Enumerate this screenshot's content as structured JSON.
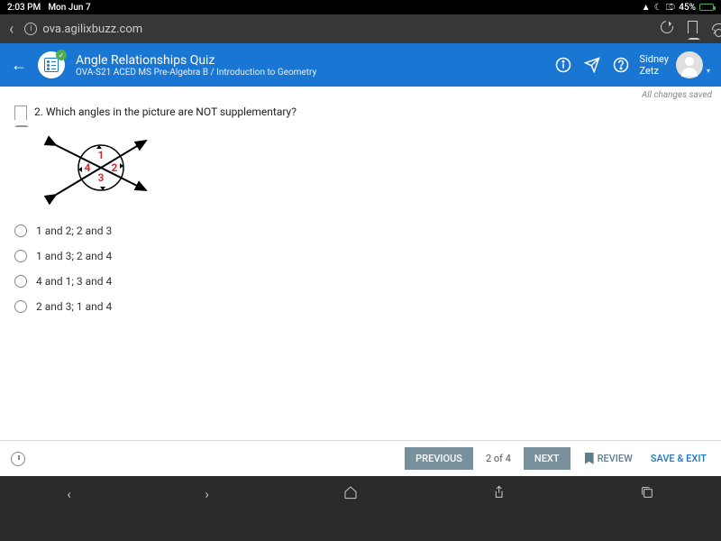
{
  "status": {
    "time": "2:03 PM",
    "date": "Mon Jun 7",
    "battery": "45%"
  },
  "browser": {
    "url": "ova.agilixbuzz.com"
  },
  "header": {
    "title": "Angle Relationships Quiz",
    "subtitle": "OVA-S21 ACED MS Pre-Algebra B / Introduction to Geometry",
    "user_first": "Sidney",
    "user_last": "Zetz"
  },
  "saved_text": "All changes saved",
  "question": {
    "number": "2.",
    "text": "Which angles in the picture are NOT supplementary?"
  },
  "diagram_labels": {
    "a1": "1",
    "a2": "2",
    "a3": "3",
    "a4": "4"
  },
  "options": [
    "1 and 2; 2 and 3",
    "1 and 3; 2 and 4",
    "4 and 1; 3 and 4",
    "2 and 3; 1 and 4"
  ],
  "footer": {
    "prev": "PREVIOUS",
    "pager": "2 of 4",
    "next": "NEXT",
    "review": "REVIEW",
    "save_exit": "SAVE & EXIT"
  }
}
